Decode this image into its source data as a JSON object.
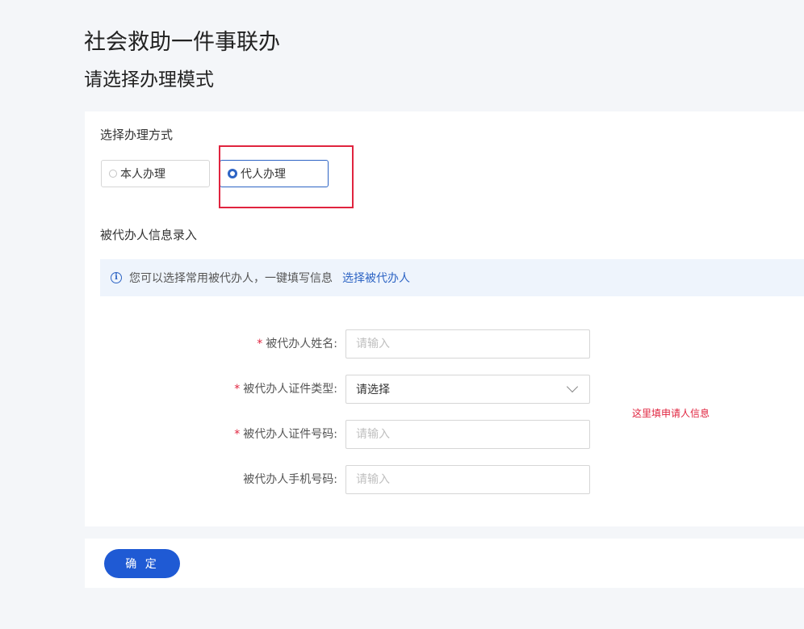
{
  "header": {
    "app_title": "社会救助一件事联办",
    "page_subtitle": "请选择办理模式"
  },
  "mode_section": {
    "label": "选择办理方式",
    "options": [
      {
        "label": "本人办理",
        "selected": false
      },
      {
        "label": "代人办理",
        "selected": true
      }
    ]
  },
  "agent_section": {
    "label": "被代办人信息录入"
  },
  "info_bar": {
    "icon": "info-circle-icon",
    "text": "您可以选择常用被代办人，一键填写信息",
    "link": "选择被代办人"
  },
  "form": {
    "name": {
      "label": "被代办人姓名:",
      "required": true,
      "placeholder": "请输入",
      "value": ""
    },
    "id_type": {
      "label": "被代办人证件类型:",
      "required": true,
      "value": "请选择"
    },
    "id_number": {
      "label": "被代办人证件号码:",
      "required": true,
      "placeholder": "请输入",
      "value": ""
    },
    "phone": {
      "label": "被代办人手机号码:",
      "required": false,
      "placeholder": "请输入",
      "value": ""
    },
    "required_mark": "*"
  },
  "note": "这里填申请人信息",
  "footer": {
    "confirm_label": "确 定"
  },
  "colors": {
    "primary": "#2d64c4",
    "button": "#1f5ad4",
    "required": "#e0243f",
    "highlight": "#e0243f",
    "info_bg": "#eef4fc"
  }
}
